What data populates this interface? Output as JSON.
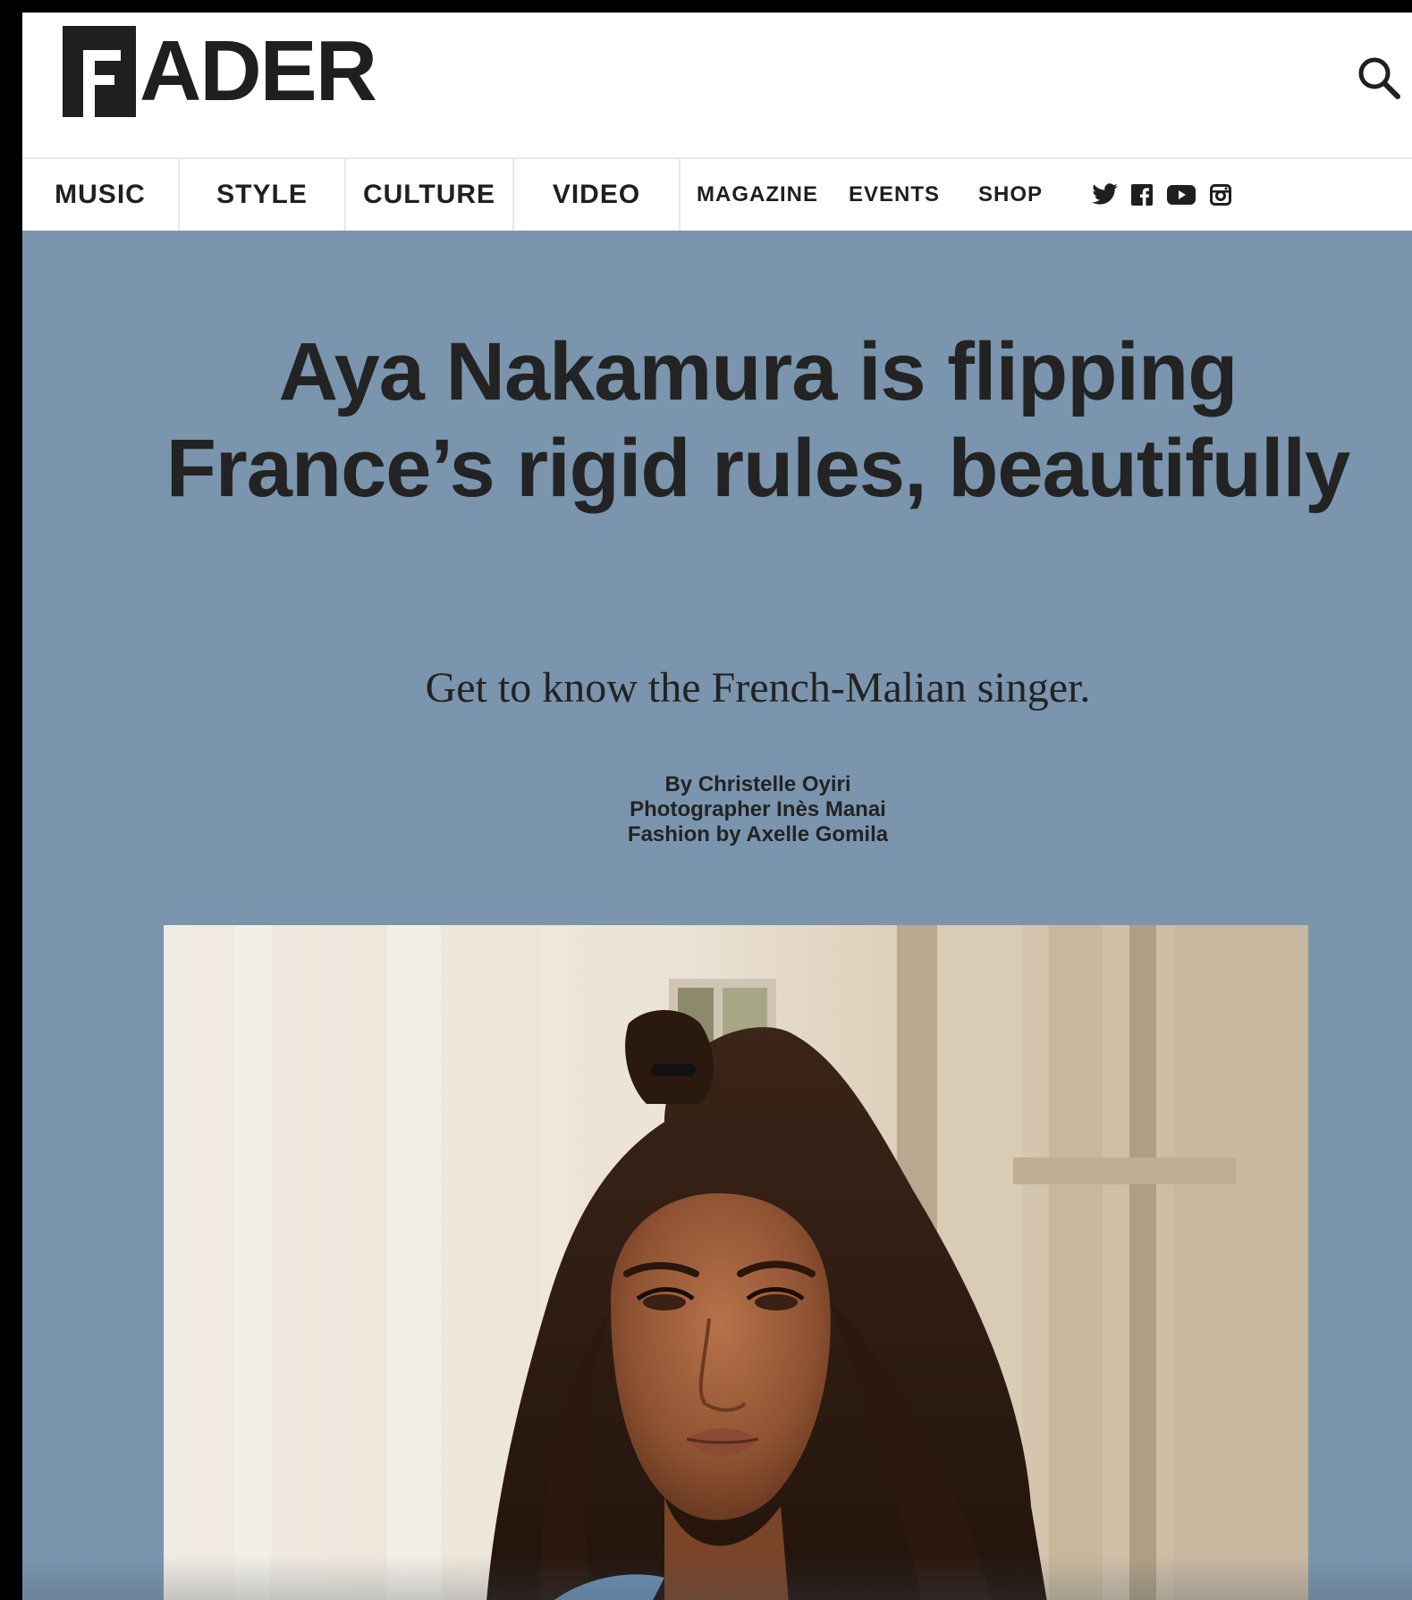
{
  "header": {
    "logo_text": "ADER",
    "logo_letter": "F"
  },
  "nav": {
    "primary": [
      "MUSIC",
      "STYLE",
      "CULTURE",
      "VIDEO"
    ],
    "secondary": [
      "MAGAZINE",
      "EVENTS",
      "SHOP"
    ],
    "social": [
      "twitter-icon",
      "facebook-icon",
      "youtube-icon",
      "instagram-icon"
    ]
  },
  "article": {
    "title": "Aya Nakamura is flipping France’s rigid rules, beautifully",
    "subtitle": "Get to know the French-Malian singer.",
    "credits": {
      "author": "By Christelle Oyiri",
      "photographer": "Photographer Inès Manai",
      "fashion": "Fashion by Axelle Gomila"
    }
  },
  "colors": {
    "background": "#7a95ad",
    "text": "#232323",
    "header_bg": "#ffffff"
  }
}
